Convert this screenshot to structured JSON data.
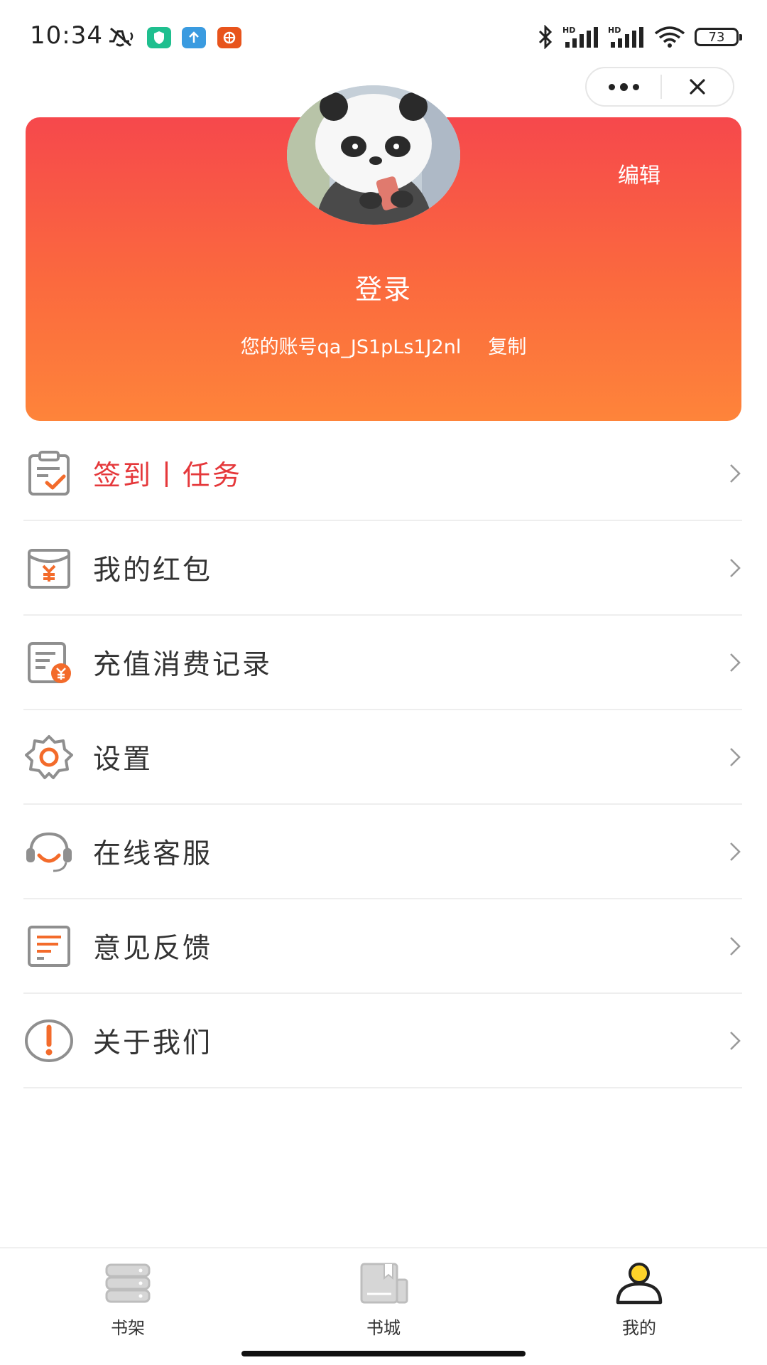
{
  "status_bar": {
    "time": "10:34",
    "battery": "73"
  },
  "capsule": {
    "more_icon": "more-dots-icon",
    "close_icon": "close-icon"
  },
  "profile": {
    "edit_label": "编辑",
    "login_label": "登录",
    "account_text": "您的账号qa_JS1pLs1J2nl",
    "copy_label": "复制",
    "gradient_top": "#f6484c",
    "gradient_bottom": "#fe843a"
  },
  "menu": {
    "items": [
      {
        "label": "签到丨任务",
        "icon": "checkin-clipboard-icon"
      },
      {
        "label": "我的红包",
        "icon": "red-packet-icon"
      },
      {
        "label": "充值消费记录",
        "icon": "recharge-record-icon"
      },
      {
        "label": "设置",
        "icon": "gear-icon"
      },
      {
        "label": "在线客服",
        "icon": "headset-icon"
      },
      {
        "label": "意见反馈",
        "icon": "feedback-icon"
      },
      {
        "label": "关于我们",
        "icon": "exclamation-icon"
      }
    ]
  },
  "tabs": [
    {
      "label": "书架",
      "icon": "bookshelf-icon",
      "active": false
    },
    {
      "label": "书城",
      "icon": "bookstore-icon",
      "active": false
    },
    {
      "label": "我的",
      "icon": "user-icon",
      "active": true
    }
  ],
  "colors": {
    "accent": "#f36b2b",
    "highlight_text": "#e5383b",
    "icon_gray": "#8f8f8f",
    "active_tab_yellow": "#ffd42a"
  }
}
